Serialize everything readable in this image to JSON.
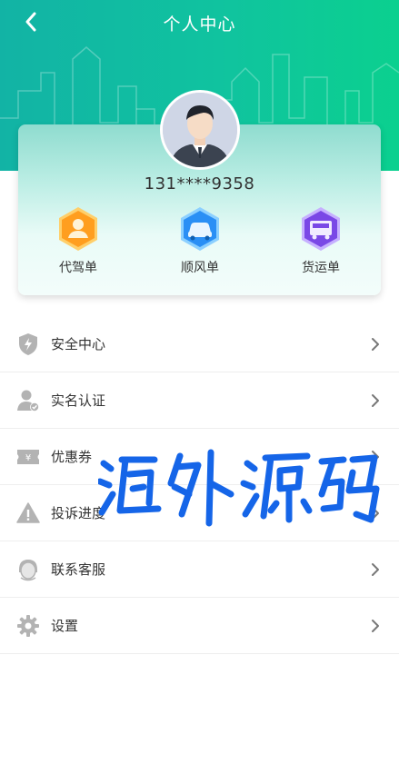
{
  "header": {
    "title": "个人中心",
    "gradient_start": "#12b3a5",
    "gradient_end": "#0bd08f"
  },
  "profile": {
    "phone": "131****9358",
    "avatar_icon": "user-avatar-icon"
  },
  "services": [
    {
      "label": "代驾单",
      "icon": "driver-icon",
      "color": "#ffa31a"
    },
    {
      "label": "顺风单",
      "icon": "car-icon",
      "color": "#2a8ff5"
    },
    {
      "label": "货运单",
      "icon": "truck-icon",
      "color": "#8b5cf0"
    }
  ],
  "menu": [
    {
      "label": "安全中心",
      "icon": "shield-icon"
    },
    {
      "label": "实名认证",
      "icon": "verified-user-icon"
    },
    {
      "label": "优惠券",
      "icon": "coupon-icon"
    },
    {
      "label": "投诉进度",
      "icon": "warning-icon"
    },
    {
      "label": "联系客服",
      "icon": "customer-service-icon"
    },
    {
      "label": "设置",
      "icon": "gear-icon"
    }
  ],
  "watermark": {
    "text": "海外源码",
    "color": "#1565e8"
  }
}
